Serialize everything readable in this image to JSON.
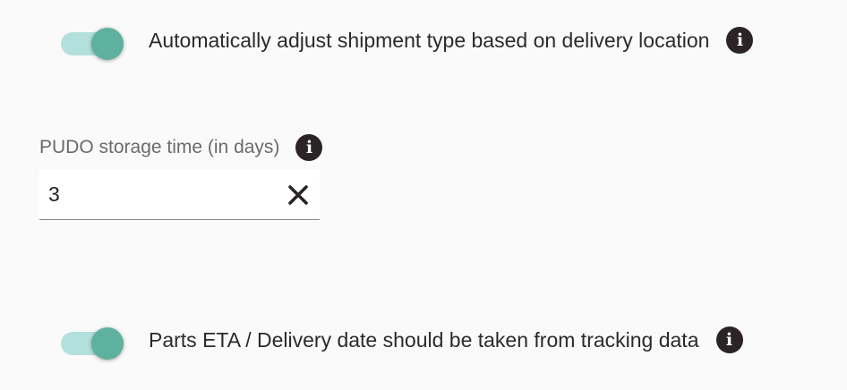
{
  "settings": {
    "auto_adjust": {
      "label": "Automatically adjust shipment type based on delivery location",
      "enabled": true,
      "info_icon": "info-icon"
    },
    "pudo_storage": {
      "label": "PUDO storage time (in days)",
      "value": "3",
      "info_icon": "info-icon",
      "clear_icon": "close-icon"
    },
    "parts_eta": {
      "label": "Parts ETA / Delivery date should be taken from tracking data",
      "enabled": true,
      "info_icon": "info-icon"
    }
  },
  "colors": {
    "toggle_track": "#b3e0dc",
    "toggle_thumb": "#5fb19f",
    "info_icon_bg": "#2a2426",
    "background": "#fafafa"
  }
}
